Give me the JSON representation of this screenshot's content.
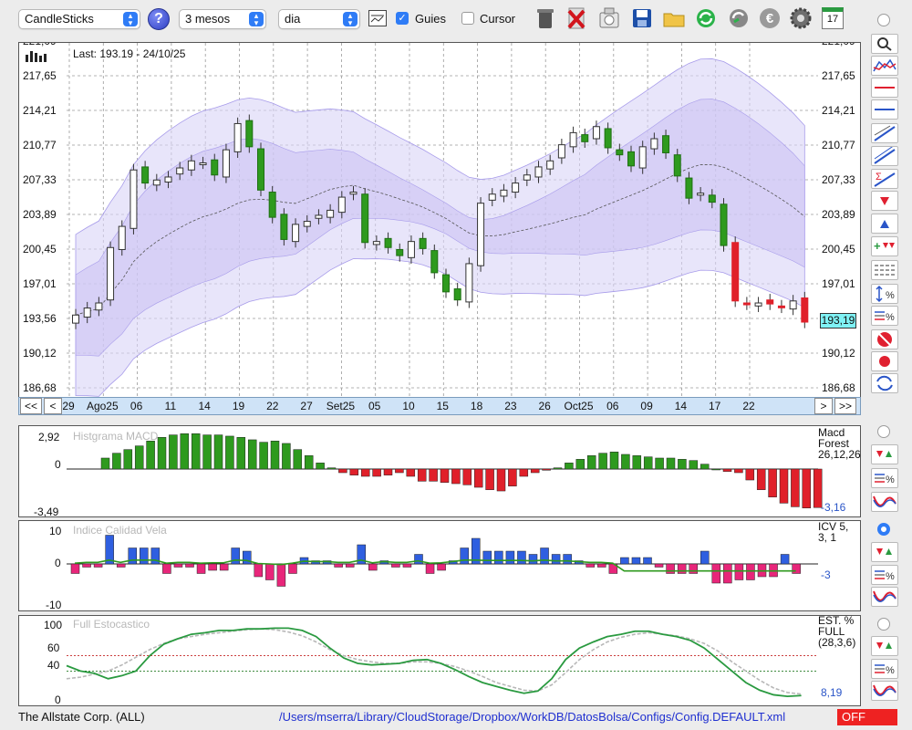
{
  "toolbar": {
    "chart_type": "CandleSticks",
    "range": "3 mesos",
    "interval": "dia",
    "guides_label": "Guies",
    "guides_checked": true,
    "cursor_label": "Cursor",
    "cursor_checked": false,
    "help_symbol": "?",
    "icons": [
      "trash-icon",
      "delete-icon",
      "toggle-icon",
      "save-icon",
      "folder-icon",
      "refresh-icon",
      "reload-icon",
      "euro-icon",
      "gear-icon",
      "calendar-icon"
    ],
    "calendar_day": "17"
  },
  "main_chart": {
    "last_label": "Last: 193.19 - 24/10/25",
    "price_tag": "193,19",
    "y_ticks": [
      "221,09",
      "217,65",
      "214,21",
      "210,77",
      "207,33",
      "203,89",
      "200,45",
      "197,01",
      "193,56",
      "190,12",
      "186,68"
    ],
    "x_ticks": [
      "29",
      "Ago25",
      "06",
      "11",
      "14",
      "19",
      "22",
      "27",
      "Set25",
      "05",
      "10",
      "15",
      "18",
      "23",
      "26",
      "Oct25",
      "06",
      "09",
      "14",
      "17",
      "22"
    ],
    "nav": {
      "first": "<<",
      "prev": "<",
      "next": ">",
      "last": ">>"
    }
  },
  "macd": {
    "title": "Histgrama MACD",
    "y_max": "2,92",
    "y_zero": "0",
    "y_min": "-3,49",
    "label": "Macd Forest 26,12,26",
    "value": "-3,16"
  },
  "icv": {
    "title": "Indice Calidad Vela",
    "y_max": "10",
    "y_zero": "0",
    "y_min": "-10",
    "label": "ICV 5, 3, 1",
    "value": "-3"
  },
  "stoch": {
    "title": "Full Estocastico",
    "ticks": [
      "100",
      "60",
      "40",
      "0"
    ],
    "label": "EST. % FULL (28,3,6)",
    "value": "8,19"
  },
  "status": {
    "company": "The Allstate Corp. (ALL)",
    "path": "/Users/mserra/Library/CloudStorage/Dropbox/WorkDB/DatosBolsa/Configs/Config.DEFAULT.xml",
    "off_label": "OFF"
  },
  "colors": {
    "up": "#2e9a1e",
    "down": "#e0202a",
    "band": "#d9d4f6",
    "accent": "#2f7cf6",
    "icv_pos": "#2f5fe0",
    "icv_neg": "#e8267a"
  },
  "chart_data": [
    {
      "type": "candlestick",
      "title": "",
      "ylim": [
        186.68,
        221.09
      ],
      "categories": [
        "29",
        "Ago25",
        "06",
        "11",
        "14",
        "19",
        "22",
        "27",
        "Set25",
        "05",
        "10",
        "15",
        "18",
        "23",
        "26",
        "Oct25",
        "06",
        "09",
        "14",
        "17",
        "22"
      ],
      "last": 193.19
    },
    {
      "type": "bar",
      "title": "Histgrama MACD",
      "ylim": [
        -3.49,
        2.92
      ],
      "last": -3.16
    },
    {
      "type": "bar",
      "title": "Indice Calidad Vela",
      "ylim": [
        -10,
        10
      ],
      "last": -3
    },
    {
      "type": "line",
      "title": "Full Estocastico",
      "ylim": [
        0,
        100
      ],
      "last": 8.19
    }
  ]
}
